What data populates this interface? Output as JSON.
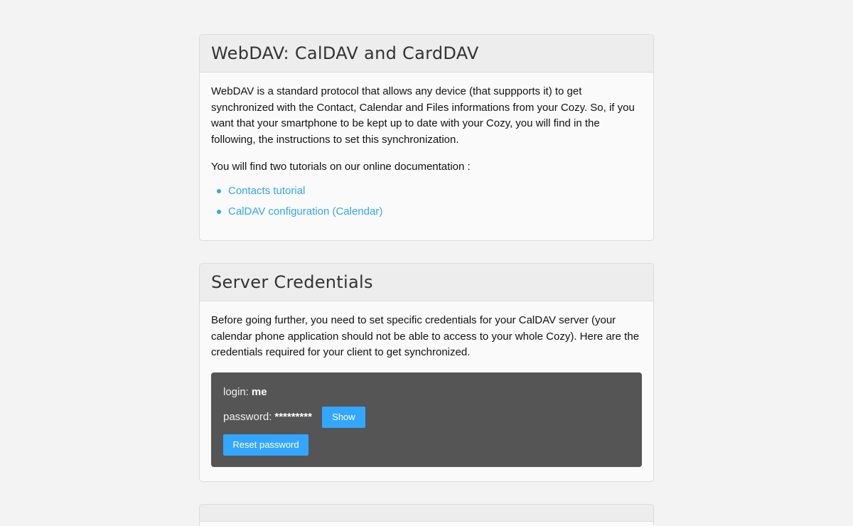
{
  "webdav": {
    "title": "WebDAV: CalDAV and CardDAV",
    "intro": "WebDAV is a standard protocol that allows any device (that suppports it) to get synchronized with the Contact, Calendar and Files informations from your Cozy. So, if you want that your smartphone to be kept up to date with your Cozy, you will find in the following, the instructions to set this synchronization.",
    "tutorials_intro": "You will find two tutorials on our online documentation :",
    "links": [
      {
        "label": "Contacts tutorial"
      },
      {
        "label": "CalDAV configuration (Calendar)"
      }
    ]
  },
  "credentials": {
    "title": "Server Credentials",
    "intro": "Before going further, you need to set specific credentials for your CalDAV server (your calendar phone application should not be able to access to your whole Cozy). Here are the credentials required for your client to get synchronized.",
    "login_label": "login:",
    "login_value": "me",
    "password_label": "password:",
    "password_value": "*********",
    "show_label": "Show",
    "reset_label": "Reset password"
  },
  "colors": {
    "accent": "#33a6e8",
    "button": "#33a6ff",
    "cred_box": "#555555",
    "background": "#f3f3f3"
  }
}
